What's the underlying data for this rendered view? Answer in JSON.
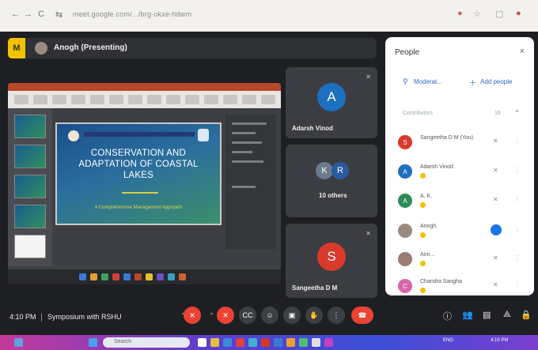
{
  "browser": {
    "url": "meet.google.com/.../brg-okxe-hdwm",
    "nav_back": "←",
    "nav_reload": "C"
  },
  "presenter": {
    "meet_logo": "M",
    "name": "Anogh (Presenting)"
  },
  "slide": {
    "title_line1": "CONSERVATION AND",
    "title_line2": "ADAPTATION OF COASTAL",
    "title_line3": "LAKES",
    "subtitle": "A Comprehensive Management Approach"
  },
  "tiles": [
    {
      "initial": "A",
      "name": "Adarsh Vinod",
      "color": "#1d6fbf"
    },
    {
      "initials": [
        "K",
        "R"
      ],
      "name": "10 others"
    },
    {
      "initial": "S",
      "name": "Sangeetha D M",
      "color": "#d93a2b"
    }
  ],
  "people_panel": {
    "title": "People",
    "close_icon": "×",
    "add_people_label": "Add people",
    "share_label": "Moderat...",
    "section_label": "Contributors",
    "section_count": "16",
    "participants": [
      {
        "initial": "S",
        "name": "Sangeetha D M (You)",
        "color": "#d93a2b"
      },
      {
        "initial": "A",
        "name": "Adarsh Vinod",
        "color": "#1d6fbf"
      },
      {
        "initial": "A",
        "name": "A. K.",
        "color": "#2e8b57"
      },
      {
        "initial": "",
        "name": "Anogh",
        "color": "#9a8b80",
        "speaking": true
      },
      {
        "initial": "",
        "name": "Ann...",
        "color": "#9a7b70"
      },
      {
        "initial": "C",
        "name": "Chandra Sangha",
        "color": "#d966a8"
      }
    ]
  },
  "controls": {
    "time": "4:10 PM",
    "meeting_name": "Symposium with RSHU",
    "mic_label": "mic",
    "cam_label": "cam"
  },
  "taskbar": {
    "search_placeholder": "Search",
    "lang": "ENG",
    "clock": "4:10 PM"
  },
  "colors": {
    "meet_bg": "#1e1f22",
    "tile_bg": "#3b3d42",
    "danger": "#ea4335",
    "accent": "#1a73e8"
  }
}
